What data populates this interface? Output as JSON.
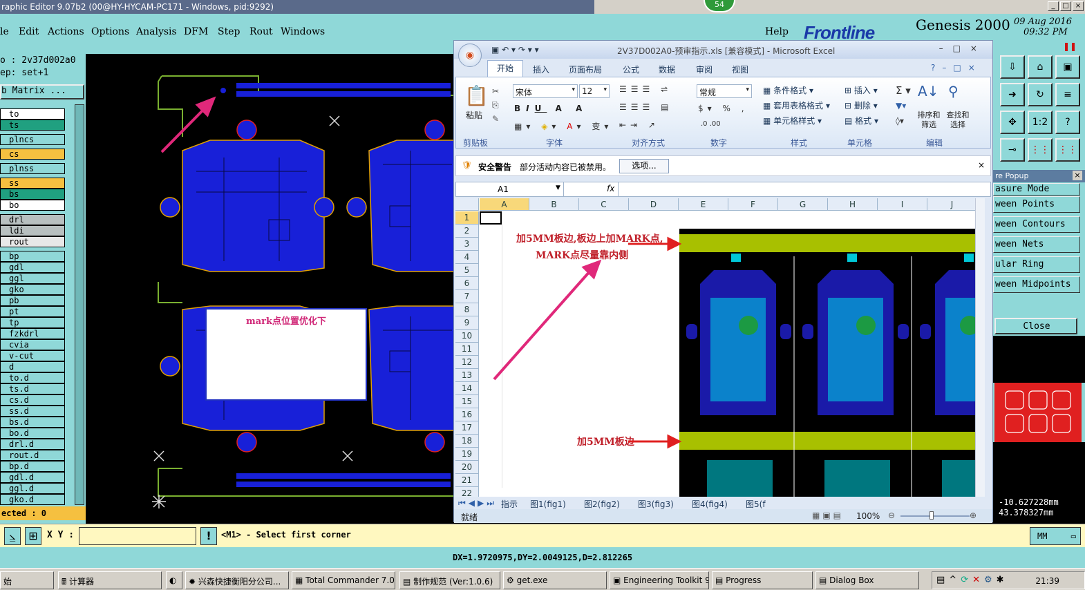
{
  "window": {
    "title": "raphic Editor 9.07b2 (00@HY-HYCAM-PC171 - Windows, pid:9292)",
    "badge": "54"
  },
  "menu": {
    "items": [
      "le",
      "Edit",
      "Actions",
      "Options",
      "Analysis",
      "DFM",
      "Step",
      "Rout",
      "Windows"
    ],
    "help": "Help"
  },
  "brand": {
    "logo": "Frontline",
    "product": "Genesis 2000",
    "date": "09 Aug 2016",
    "time": "09:32 PM"
  },
  "left": {
    "job": "o : 2v37d002a0",
    "step": "ep: set+1",
    "matrix": "b Matrix ...",
    "selected": "ected : 0",
    "layers": [
      {
        "name": "to",
        "bg": "#ffffff"
      },
      {
        "name": "ts",
        "bg": "#20a080"
      },
      {
        "name": "plncs",
        "bg": "#8fd8d8"
      },
      {
        "name": "cs",
        "bg": "#f5c040"
      },
      {
        "name": "plnss",
        "bg": "#8fd8d8"
      },
      {
        "name": "ss",
        "bg": "#f5c040"
      },
      {
        "name": "bs",
        "bg": "#20a080"
      },
      {
        "name": "bo",
        "bg": "#ffffff"
      },
      {
        "name": "drl",
        "bg": "#b8c0c0"
      },
      {
        "name": "ldi",
        "bg": "#b8c0c0"
      },
      {
        "name": "rout",
        "bg": "#e8e8e8"
      },
      {
        "name": "bp",
        "bg": "#8fd8d8"
      },
      {
        "name": "gdl",
        "bg": "#8fd8d8"
      },
      {
        "name": "ggl",
        "bg": "#8fd8d8"
      },
      {
        "name": "gko",
        "bg": "#8fd8d8"
      },
      {
        "name": "pb",
        "bg": "#8fd8d8"
      },
      {
        "name": "pt",
        "bg": "#8fd8d8"
      },
      {
        "name": "tp",
        "bg": "#8fd8d8"
      },
      {
        "name": "fzkdrl",
        "bg": "#8fd8d8"
      },
      {
        "name": "cvia",
        "bg": "#8fd8d8"
      },
      {
        "name": "v-cut",
        "bg": "#8fd8d8"
      },
      {
        "name": "d",
        "bg": "#8fd8d8"
      },
      {
        "name": "to.d",
        "bg": "#8fd8d8"
      },
      {
        "name": "ts.d",
        "bg": "#8fd8d8"
      },
      {
        "name": "cs.d",
        "bg": "#8fd8d8"
      },
      {
        "name": "ss.d",
        "bg": "#8fd8d8"
      },
      {
        "name": "bs.d",
        "bg": "#8fd8d8"
      },
      {
        "name": "bo.d",
        "bg": "#8fd8d8"
      },
      {
        "name": "drl.d",
        "bg": "#8fd8d8"
      },
      {
        "name": "rout.d",
        "bg": "#8fd8d8"
      },
      {
        "name": "bp.d",
        "bg": "#8fd8d8"
      },
      {
        "name": "gdl.d",
        "bg": "#8fd8d8"
      },
      {
        "name": "ggl.d",
        "bg": "#8fd8d8"
      },
      {
        "name": "gko.d",
        "bg": "#8fd8d8"
      }
    ]
  },
  "canvas": {
    "note": "mark点位置优化下"
  },
  "right": {
    "popup_title": "re Popup",
    "modes": [
      "asure Mode",
      "ween Points",
      "ween Contours",
      "ween Nets",
      "ular Ring",
      "ween Midpoints"
    ],
    "close": "Close",
    "coord_x": "-10.627228mm",
    "coord_y": "43.378327mm",
    "units": "MM"
  },
  "cmd": {
    "xy_label": "X Y :",
    "prompt": "<M1> - Select first corner",
    "dx": "DX=1.9720975,DY=2.0049125,D=2.812265"
  },
  "excel": {
    "title": "2V37D002A0-预审指示.xls  [兼容模式] - Microsoft Excel",
    "tabs": [
      "开始",
      "插入",
      "页面布局",
      "公式",
      "数据",
      "审阅",
      "视图"
    ],
    "clipboard": {
      "paste": "粘贴",
      "label": "剪贴板"
    },
    "font": {
      "name": "宋体",
      "size": "12",
      "label": "字体"
    },
    "align_label": "对齐方式",
    "number": {
      "format": "常规",
      "label": "数字"
    },
    "styles": {
      "cond": "条件格式",
      "table": "套用表格格式",
      "cell": "单元格样式",
      "label": "样式"
    },
    "cells": {
      "insert": "插入",
      "delete": "删除",
      "format": "格式",
      "label": "单元格"
    },
    "edit": {
      "sort": "排序和筛选",
      "find": "查找和选择",
      "label": "编辑"
    },
    "security": {
      "label": "安全警告",
      "msg": "部分活动内容已被禁用。",
      "options": "选项..."
    },
    "namebox": "A1",
    "fx": "fx",
    "columns": [
      "A",
      "B",
      "C",
      "D",
      "E",
      "F",
      "G",
      "H",
      "I",
      "J"
    ],
    "rows": [
      "1",
      "2",
      "3",
      "4",
      "5",
      "6",
      "7",
      "8",
      "9",
      "10",
      "11",
      "12",
      "13",
      "14",
      "15",
      "16",
      "17",
      "18",
      "19",
      "20",
      "21",
      "22"
    ],
    "ann1": "加5MM板边,板边上加MARK点,",
    "ann2": "MARK点尽量靠内侧",
    "ann3": "加5MM板边",
    "sheets": [
      "指示",
      "图1(fig1)",
      "图2(fig2)",
      "图3(fig3)",
      "图4(fig4)",
      "图5(f"
    ],
    "status": "就绪",
    "zoom": "100%"
  },
  "taskbar": {
    "start": "始",
    "items": [
      "计算器",
      "",
      "兴森快捷衡阳分公司...",
      "Total Commander 7.0 ...",
      "制作规范 (Ver:1.0.6)",
      "get.exe",
      "Engineering Toolkit 9.0...",
      "Progress",
      "Dialog Box"
    ],
    "clock": "21:39"
  }
}
